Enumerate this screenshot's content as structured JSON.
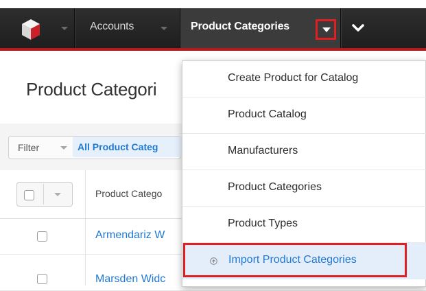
{
  "navbar": {
    "logo": "sugarcube-logo-icon",
    "tabs": [
      {
        "label": "Accounts"
      },
      {
        "label": "Product Categories"
      }
    ],
    "more_icon": "chevron-down-icon"
  },
  "page": {
    "title": "Product Categori",
    "filter": {
      "label": "Filter",
      "value": "All Product Categ"
    },
    "list": {
      "column_header": "Product Catego",
      "rows": [
        {
          "name": "Armendariz W"
        },
        {
          "name": "Marsden Widc"
        }
      ]
    }
  },
  "menu": {
    "items": [
      {
        "label": "Create Product for Catalog"
      },
      {
        "label": "Product Catalog"
      },
      {
        "label": "Manufacturers"
      },
      {
        "label": "Product Categories"
      },
      {
        "label": "Product Types"
      },
      {
        "label": "Import Product Categories",
        "icon": "import-icon"
      }
    ]
  },
  "colors": {
    "navbar": "#2a2a2a",
    "accent_red": "#e02020",
    "link_blue": "#1f78d1",
    "highlight": "#e4eefa"
  }
}
